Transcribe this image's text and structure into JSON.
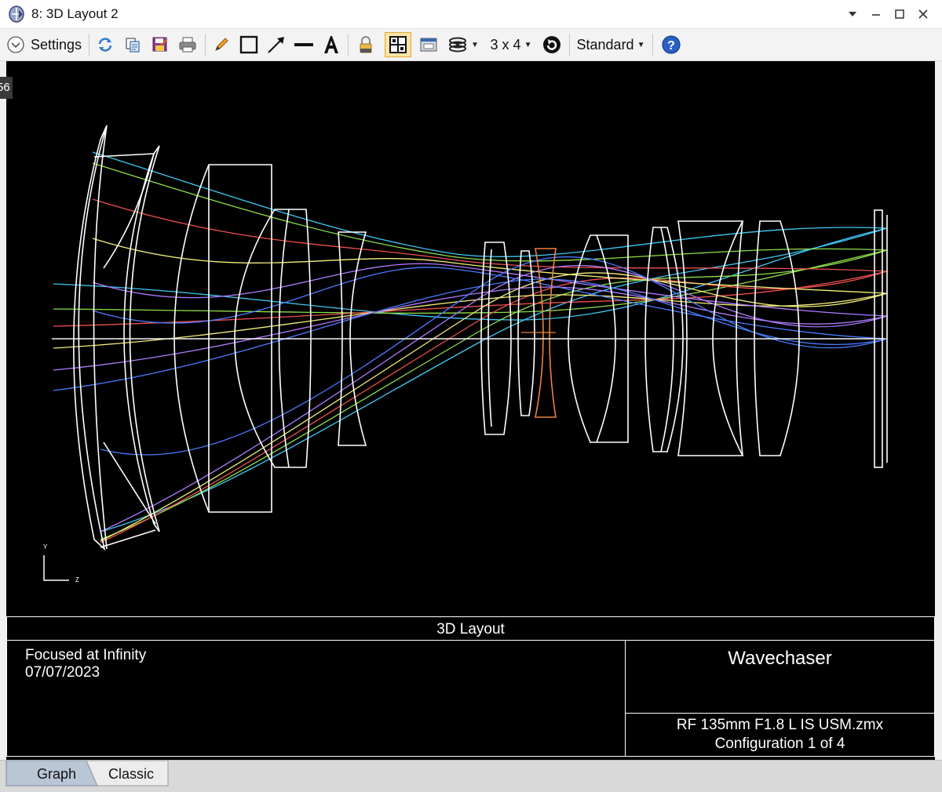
{
  "window": {
    "title": "8: 3D Layout 2",
    "controls": [
      "chevron-down",
      "minimize",
      "maximize",
      "close"
    ]
  },
  "toolbar": {
    "settings_label": "Settings",
    "grid_label": "3 x 4",
    "standard_label": "Standard",
    "icons": [
      "refresh",
      "copy",
      "save-as",
      "print",
      "pencil",
      "rectangle",
      "arrow",
      "line",
      "text",
      "lock",
      "layout-grid",
      "window",
      "layers",
      "rotate",
      "help"
    ]
  },
  "graph": {
    "side_tab_text": "56",
    "axis_y": "Y",
    "axis_z": "Z",
    "ray_colors": [
      "#3fc8f4",
      "#8ee04a",
      "#f05050",
      "#f5f07a",
      "#b07cff",
      "#4a7cff",
      "#f5f5f5"
    ],
    "lens_color": "#ffffff",
    "stop_color": "#f08040"
  },
  "info": {
    "title": "3D Layout",
    "left_line1": "Focused at Infinity",
    "left_line2": "07/07/2023",
    "company": "Wavechaser",
    "file_name": "RF 135mm F1.8 L IS USM.zmx",
    "configuration": "Configuration 1 of 4"
  },
  "tabs": [
    {
      "label": "Graph",
      "active": true
    },
    {
      "label": "Classic",
      "active": false
    }
  ]
}
